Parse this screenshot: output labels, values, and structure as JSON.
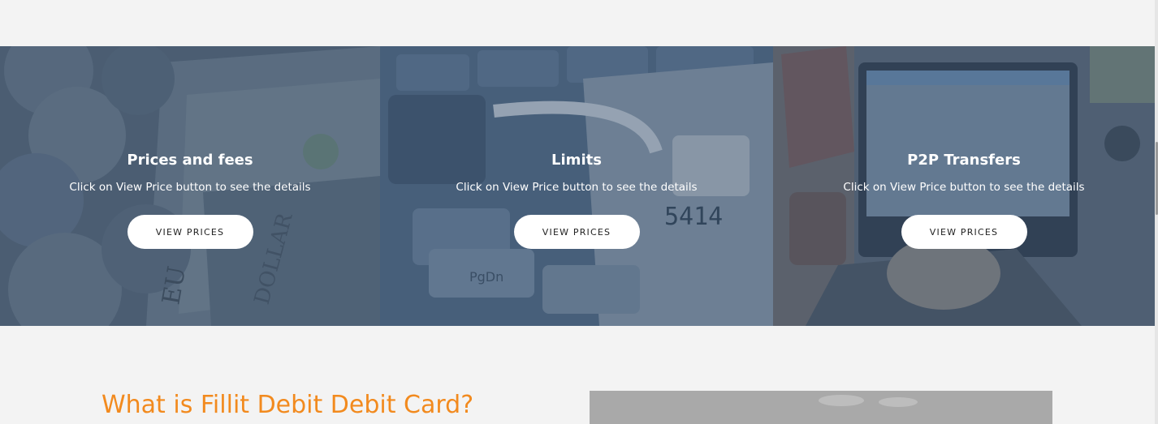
{
  "cards": [
    {
      "title": "Prices and fees",
      "text": "Click on View Price button to see the details",
      "button": "VIEW PRICES"
    },
    {
      "title": "Limits",
      "text": "Click on View Price button to see the details",
      "button": "VIEW PRICES"
    },
    {
      "title": "P2P Transfers",
      "text": "Click on View Price button to see the details",
      "button": "VIEW PRICES"
    }
  ],
  "about": {
    "title": "What is Fillit Debit Debit Card?"
  },
  "colors": {
    "accent": "#f28a1e",
    "background": "#f3f3f3",
    "button_bg": "#ffffff"
  },
  "icons": {
    "card_backgrounds": [
      "coins-and-banknotes-photo",
      "padlock-on-keyboard-photo",
      "laptop-desk-photo"
    ]
  }
}
